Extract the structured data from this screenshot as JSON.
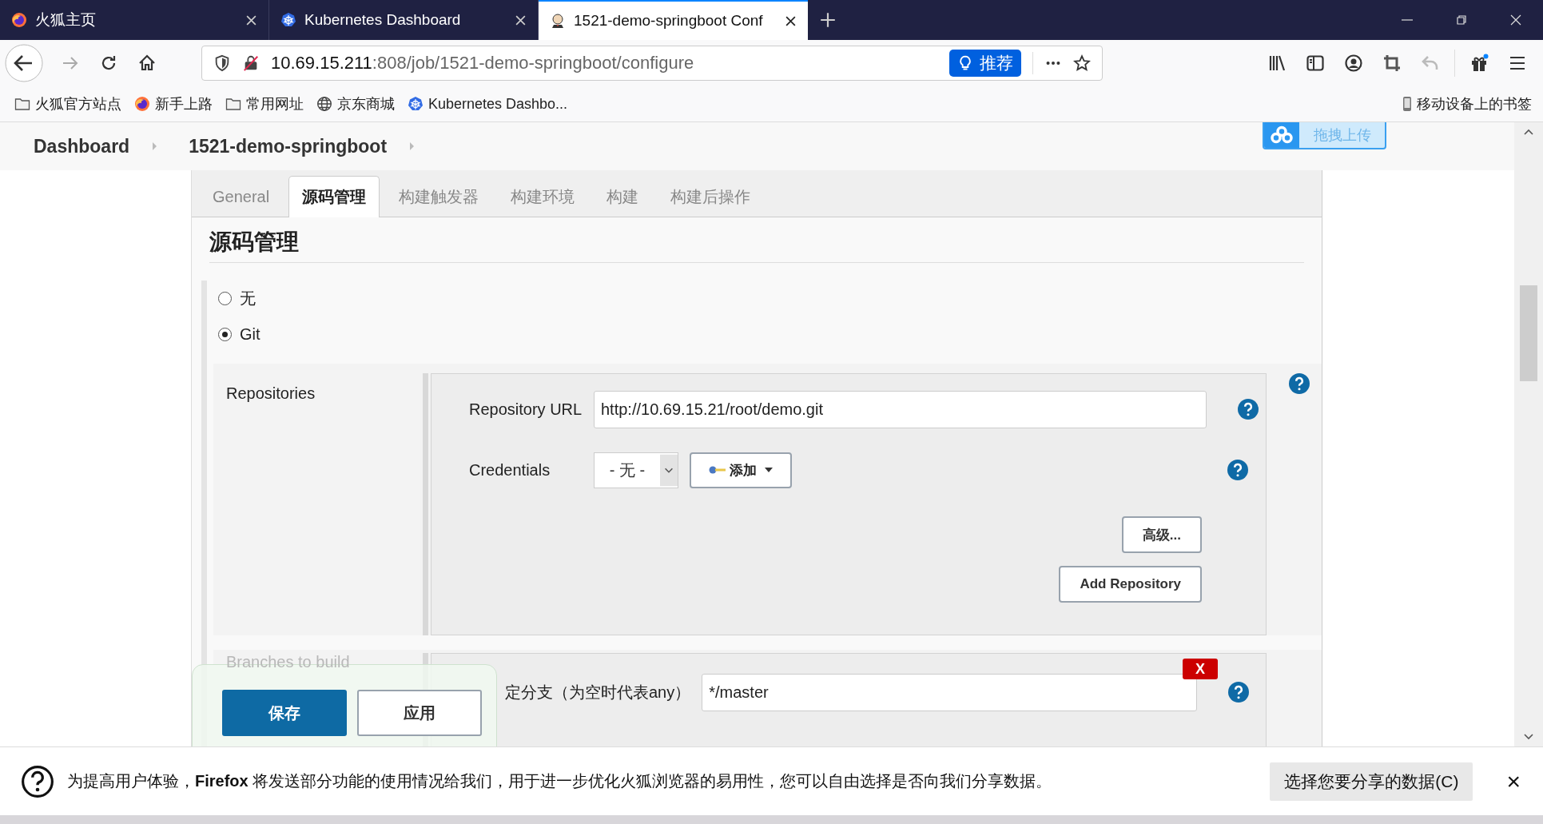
{
  "browser_tabs": [
    {
      "title": "火狐主页",
      "selected": false,
      "kind": "firefox"
    },
    {
      "title": "Kubernetes Dashboard",
      "selected": false,
      "kind": "kubernetes"
    },
    {
      "title": "1521-demo-springboot Conf",
      "selected": true,
      "kind": "jenkins"
    }
  ],
  "address_bar": {
    "host": "10.69.15.211",
    "path": ":808/job/1521-demo-springboot/configure",
    "recommend_label": "推荐"
  },
  "bookmarks": [
    {
      "label": "火狐官方站点",
      "kind": "folder"
    },
    {
      "label": "新手上路",
      "kind": "firefox"
    },
    {
      "label": "常用网址",
      "kind": "folder"
    },
    {
      "label": "京东商城",
      "kind": "globe"
    },
    {
      "label": "Kubernetes Dashbo...",
      "kind": "kubernetes"
    }
  ],
  "mobile_bookmarks": "移动设备上的书签",
  "breadcrumbs": [
    "Dashboard",
    "1521-demo-springboot"
  ],
  "upload_widget": {
    "label": "拖拽上传"
  },
  "config_tabs": [
    {
      "label": "General",
      "selected": false
    },
    {
      "label": "源码管理",
      "selected": true
    },
    {
      "label": "构建触发器",
      "selected": false
    },
    {
      "label": "构建环境",
      "selected": false
    },
    {
      "label": "构建",
      "selected": false
    },
    {
      "label": "构建后操作",
      "selected": false
    }
  ],
  "section_title": "源码管理",
  "scm_options": [
    {
      "label": "无",
      "selected": false
    },
    {
      "label": "Git",
      "selected": true
    }
  ],
  "repositories": {
    "label": "Repositories",
    "url_label": "Repository URL",
    "url_value": "http://10.69.15.21/root/demo.git",
    "credentials_label": "Credentials",
    "credentials_value": "- 无 -",
    "add_button": "添加",
    "advanced_button": "高级...",
    "add_repository_button": "Add Repository"
  },
  "branches": {
    "label": "Branches to build",
    "branch_label": "定分支（为空时代表any）",
    "branch_value": "*/master",
    "delete_button": "X"
  },
  "save_bar": {
    "save": "保存",
    "apply": "应用"
  },
  "notification": {
    "message": "为提高用户体验，**Firefox** 将发送部分功能的使用情况给我们，用于进一步优化火狐浏览器的易用性，您可以自由选择是否向我们分享数据。",
    "button": "选择您要分享的数据(C)",
    "close": "×"
  }
}
